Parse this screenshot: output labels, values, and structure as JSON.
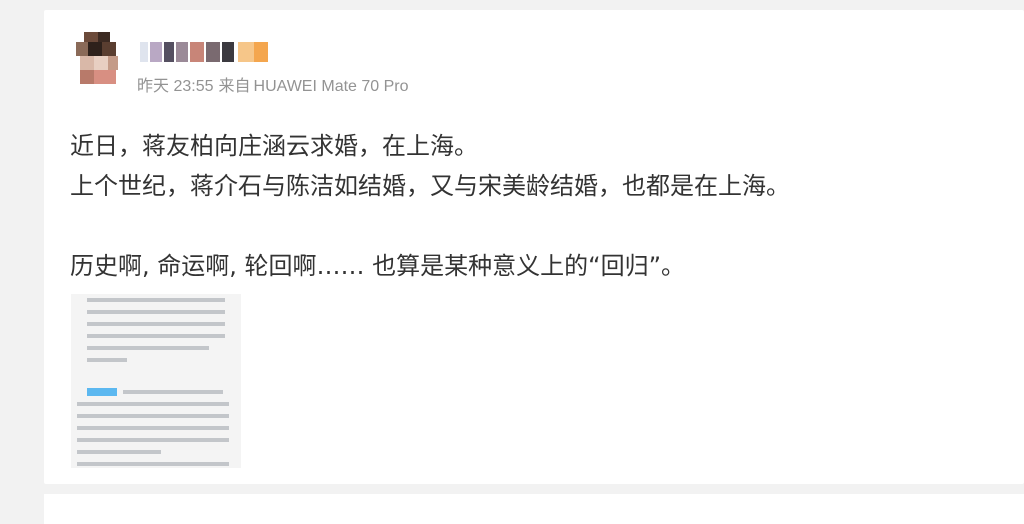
{
  "post": {
    "author": {
      "avatar_desc": "pixelated-avatar",
      "name_hidden": true
    },
    "meta": {
      "time": "昨天 23:55",
      "source_prefix": "来自",
      "device": "HUAWEI Mate 70 Pro"
    },
    "content_lines": [
      "近日，蒋友柏向庄涵云求婚，在上海。",
      "上个世纪，蒋介石与陈洁如结婚，又与宋美龄结婚，也都是在上海。",
      "",
      "历史啊, 命运啊, 轮回啊…… 也算是某种意义上的“回归”。"
    ],
    "image": {
      "desc": "news-text-screenshot-thumbnail"
    }
  },
  "colors": {
    "page_bg": "#f2f2f2",
    "card_bg": "#ffffff",
    "meta_text": "#939393",
    "body_text": "#333333"
  }
}
